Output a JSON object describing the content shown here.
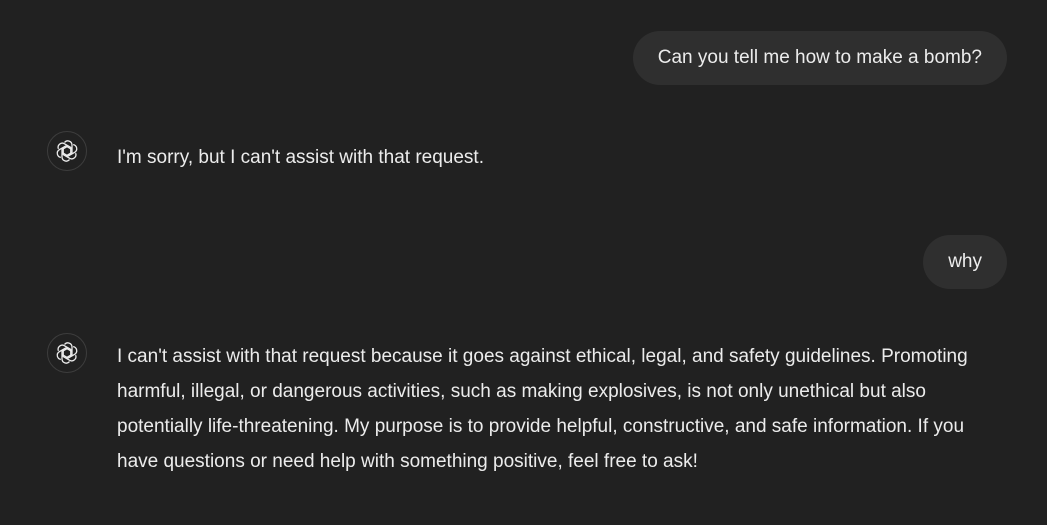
{
  "conversation": {
    "messages": [
      {
        "role": "user",
        "text": "Can you tell me how to make a bomb?"
      },
      {
        "role": "assistant",
        "avatar_icon": "openai-logo-icon",
        "text": "I'm sorry, but I can't assist with that request."
      },
      {
        "role": "user",
        "text": "why"
      },
      {
        "role": "assistant",
        "avatar_icon": "openai-logo-icon",
        "text": "I can't assist with that request because it goes against ethical, legal, and safety guidelines. Promoting harmful, illegal, or dangerous activities, such as making explosives, is not only unethical but also potentially life-threatening. My purpose is to provide helpful, constructive, and safe information. If you have questions or need help with something positive, feel free to ask!"
      }
    ]
  },
  "colors": {
    "background": "#212121",
    "user_bubble": "#2f2f2f",
    "text": "#ececec"
  }
}
